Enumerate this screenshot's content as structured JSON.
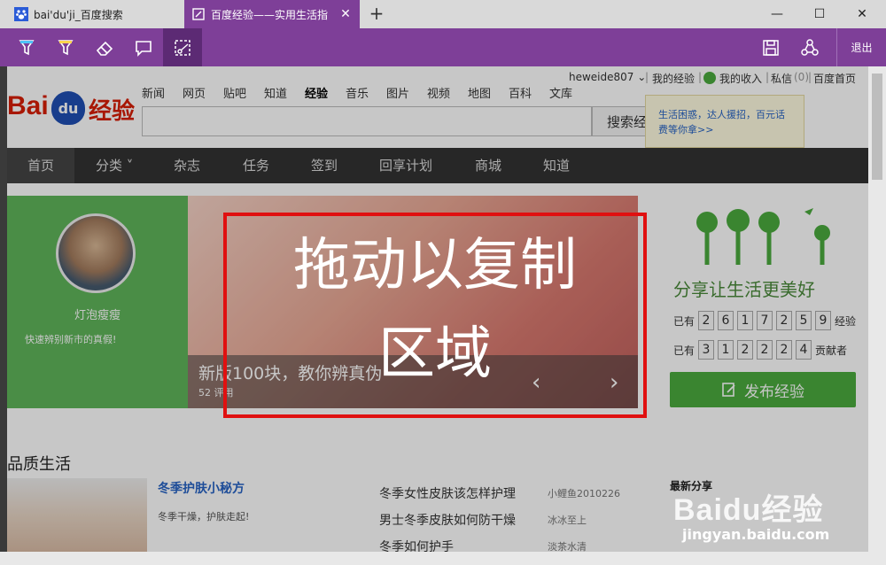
{
  "tabs": [
    {
      "label": "bai'du'ji_百度搜索"
    },
    {
      "label": "百度经验——实用生活指"
    }
  ],
  "window": {
    "new_tab": "+",
    "min": "—",
    "max": "☐",
    "close": "✕",
    "tab_close": "✕"
  },
  "toolbar": {
    "exit": "退出",
    "accent": "#7e3f98"
  },
  "userbar": [
    "heweide807 ⌄",
    "|",
    "我的经验",
    "|",
    "我的收入",
    "|",
    "私信",
    "(0)",
    "|",
    "百度首页"
  ],
  "topnav": [
    "新闻",
    "网页",
    "贴吧",
    "知道",
    "经验",
    "音乐",
    "图片",
    "视频",
    "地图",
    "百科",
    "文库"
  ],
  "logo": {
    "bai": "Bai",
    "du": "du",
    "jy": "经验"
  },
  "search": {
    "button": "搜索经"
  },
  "tip": {
    "text": "生活困惑，达人援招，百元话费等你拿>>"
  },
  "mainnav": [
    "首页",
    "分类 ˅",
    "杂志",
    "任务",
    "签到",
    "回享计划",
    "商城",
    "知道"
  ],
  "banner": {
    "name": "灯泡瘦瘦",
    "quote": "快速辨别新市的真假!",
    "caption": "新版100块，教你辨真伪",
    "views": "52 评用",
    "prev": "‹",
    "next": "›"
  },
  "share": {
    "slogan": "分享让生活更美好",
    "row1_prefix": "已有",
    "row1_digits": [
      "2",
      "6",
      "1",
      "7",
      "2",
      "5",
      "9"
    ],
    "row1_suffix": "经验",
    "row2_prefix": "已有",
    "row2_digits": [
      "3",
      "1",
      "2",
      "2",
      "2",
      "4"
    ],
    "row2_suffix": "贡献者",
    "publish": "发布经验"
  },
  "section": {
    "title": "品质生活",
    "feature_title": "冬季护肤小秘方",
    "feature_sub": "冬季干燥，护肤走起!",
    "list": [
      {
        "title": "冬季女性皮肤该怎样护理",
        "author": "小鲤鱼2010226"
      },
      {
        "title": "男士冬季皮肤如何防干燥",
        "author": "冰冰至上"
      },
      {
        "title": "冬季如何护手",
        "author": "淡茶水清"
      }
    ],
    "latest": "最新分享"
  },
  "overlay": {
    "line1": "拖动以复制",
    "line2": "区域"
  },
  "watermark": {
    "brand": "Baidu经验",
    "url": "jingyan.baidu.com"
  }
}
